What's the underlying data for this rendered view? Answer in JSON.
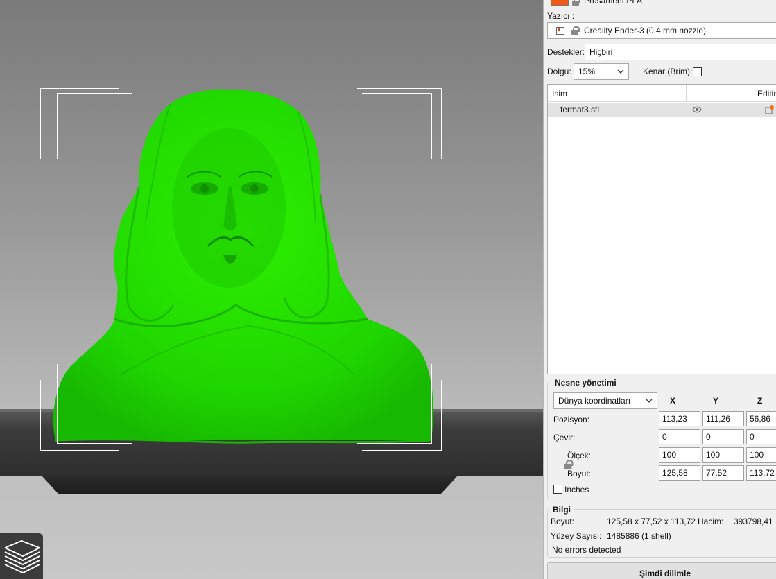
{
  "sidebar": {
    "filament_name": "Prusament PLA",
    "filament_color": "#f05a14",
    "printer_label": "Yazıcı :",
    "printer_value": "Creality Ender-3 (0.4 mm nozzle)",
    "supports_label": "Destekler:",
    "supports_value": "Hiçbiri",
    "infill_label": "Dolgu:",
    "infill_value": "15%",
    "brim_label": "Kenar (Brim):",
    "brim_checked": false
  },
  "object_list": {
    "columns": [
      "İsim",
      "",
      "Editin"
    ],
    "rows": [
      {
        "name": "fermat3.stl",
        "visibility_icon": "eye-icon",
        "edit_icon": "edit-settings-icon"
      }
    ]
  },
  "object_manipulation": {
    "title": "Nesne yönetimi",
    "coord_system": "Dünya koordinatları",
    "axes": [
      "X",
      "Y",
      "Z"
    ],
    "position_label": "Pozisyon:",
    "position": [
      "113,23",
      "111,26",
      "56,86"
    ],
    "rotation_label": "Çevir:",
    "rotation": [
      "0",
      "0",
      "0"
    ],
    "scale_label": "Ölçek:",
    "scale": [
      "100",
      "100",
      "100"
    ],
    "size_label": "Boyut:",
    "size": [
      "125,58",
      "77,52",
      "113,72"
    ],
    "inches_label": "Inches",
    "inches_checked": false
  },
  "info": {
    "title": "Bilgi",
    "size_label": "Boyut:",
    "size_value": "125,58 x 77,52 x 113,72",
    "volume_label": "Hacim:",
    "volume_value": "393798,41",
    "facets_label": "Yüzey Sayısı:",
    "facets_value": "1485886 (1 shell)",
    "errors_text": "No errors detected"
  },
  "slice_button_label": "Şimdi dilimle",
  "viewport": {
    "model_color": "#22dd00",
    "layers_icon": "layers-icon"
  }
}
